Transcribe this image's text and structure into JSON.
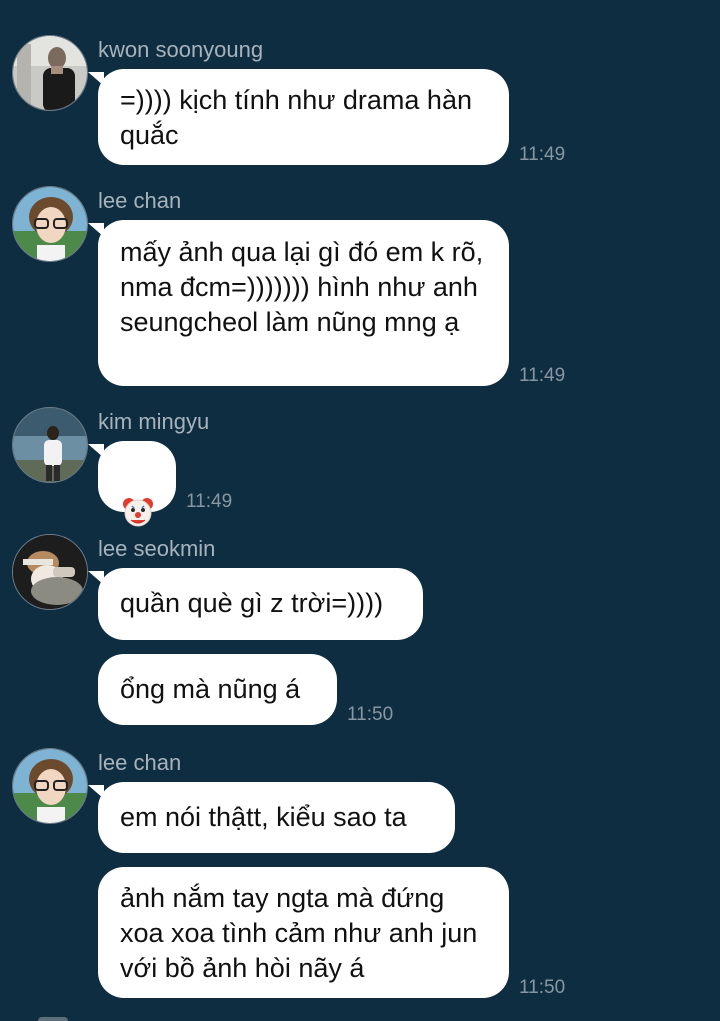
{
  "messages": [
    {
      "sender": "kwon soonyoung",
      "bubbles": [
        "=)))) kịch tính như drama hàn quắc"
      ],
      "time": "11:49"
    },
    {
      "sender": "lee chan",
      "bubbles": [
        "mấy ảnh qua lại gì đó em k rõ, nma đcm=))))))) hình như anh seungcheol làm nũng mng ạ"
      ],
      "time": "11:49"
    },
    {
      "sender": "kim mingyu",
      "bubbles": [
        "clown-face-emoji"
      ],
      "time": "11:49"
    },
    {
      "sender": "lee seokmin",
      "bubbles": [
        "quần què gì z trời=))))",
        "ổng mà nũng á"
      ],
      "time": "11:50"
    },
    {
      "sender": "lee chan",
      "bubbles": [
        "em nói thậtt, kiểu sao ta",
        "ảnh nắm tay ngta mà đứng xoa xoa tình cảm như anh jun với bồ ảnh hòi nãy á"
      ],
      "time": "11:50"
    }
  ],
  "colors": {
    "background": "#0f2d40",
    "bubble": "#ffffff",
    "name": "#a6b3bd",
    "time": "#8797a3"
  }
}
